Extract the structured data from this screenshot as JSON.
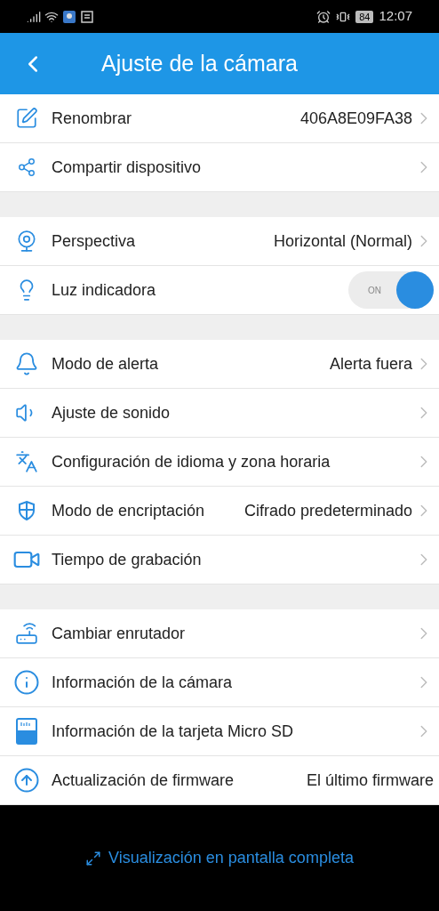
{
  "status_bar": {
    "battery": "84",
    "time": "12:07"
  },
  "header": {
    "title": "Ajuste de la cámara"
  },
  "sections": [
    {
      "items": [
        {
          "kind": "nav",
          "label": "Renombrar",
          "value": "406A8E09FA38"
        },
        {
          "kind": "nav",
          "label": "Compartir dispositivo"
        }
      ]
    },
    {
      "items": [
        {
          "kind": "nav",
          "label": "Perspectiva",
          "value": "Horizontal (Normal)"
        },
        {
          "kind": "toggle",
          "label": "Luz indicadora",
          "on": true,
          "toggle_text": "ON"
        }
      ]
    },
    {
      "items": [
        {
          "kind": "nav",
          "label": "Modo de alerta",
          "value": "Alerta fuera"
        },
        {
          "kind": "nav",
          "label": "Ajuste de sonido"
        },
        {
          "kind": "nav",
          "label": "Configuración de idioma y zona horaria"
        },
        {
          "kind": "nav",
          "label": "Modo de encriptación",
          "value": "Cifrado predeterminado"
        },
        {
          "kind": "nav",
          "label": "Tiempo de grabación"
        }
      ]
    },
    {
      "items": [
        {
          "kind": "nav",
          "label": "Cambiar enrutador"
        },
        {
          "kind": "nav",
          "label": "Información de la cámara"
        },
        {
          "kind": "nav",
          "label": "Información de la tarjeta Micro SD"
        },
        {
          "kind": "info",
          "label": "Actualización de firmware",
          "value": "El último firmware"
        }
      ]
    }
  ],
  "footer": {
    "link": "Visualización en pantalla completa"
  }
}
